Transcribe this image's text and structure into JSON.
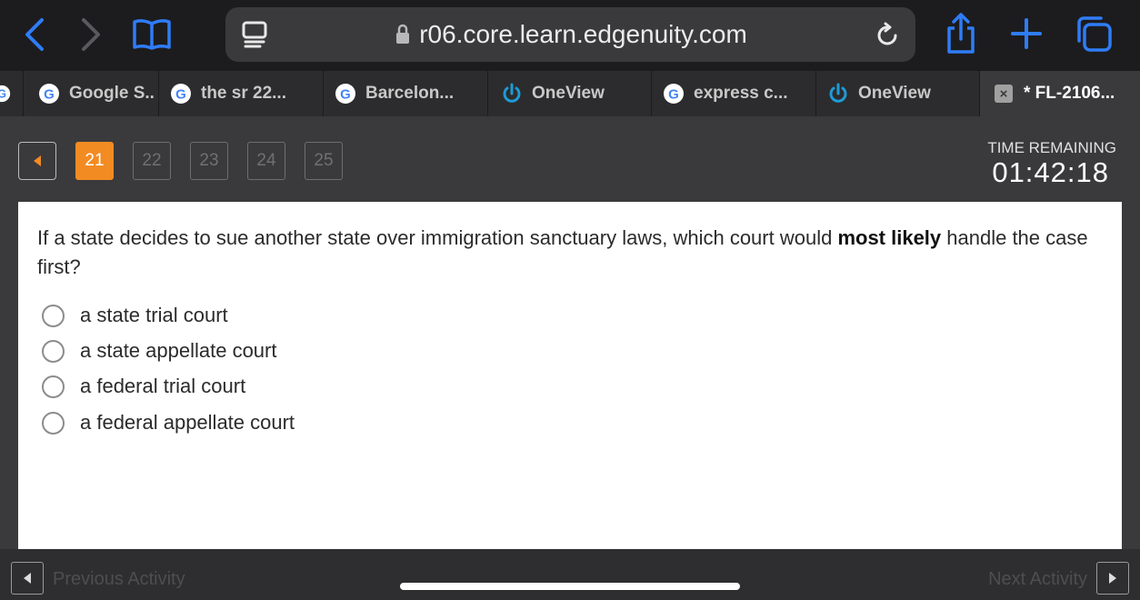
{
  "browser": {
    "url": "r06.core.learn.edgenuity.com",
    "accent_color": "#2f7cf6"
  },
  "tabs": [
    {
      "label": "Google S..",
      "icon": "google-icon"
    },
    {
      "label": "the sr 22...",
      "icon": "google-icon"
    },
    {
      "label": "Barcelon...",
      "icon": "google-icon"
    },
    {
      "label": "OneView",
      "icon": "power-icon"
    },
    {
      "label": "express c...",
      "icon": "google-icon"
    },
    {
      "label": "OneView",
      "icon": "power-icon"
    },
    {
      "label": "* FL-2106...",
      "icon": "close-icon",
      "active": true
    }
  ],
  "quiz": {
    "question_numbers": [
      "21",
      "22",
      "23",
      "24",
      "25"
    ],
    "current_question": "21",
    "timer_label": "TIME REMAINING",
    "timer_value": "01:42:18",
    "question_part1": "If a state decides to sue another state over immigration sanctuary laws, which court would ",
    "question_bold": "most likely",
    "question_part2": " handle the case first?",
    "choices": [
      "a state trial court",
      "a state appellate court",
      "a federal trial court",
      "a federal appellate court"
    ],
    "accent_color": "#f28b22"
  },
  "footer": {
    "previous_label": "Previous Activity",
    "next_label": "Next Activity"
  }
}
